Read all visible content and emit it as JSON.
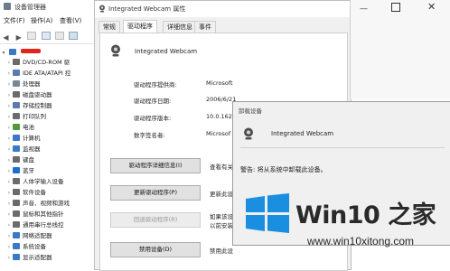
{
  "device_manager": {
    "title": "设备管理器",
    "menu": [
      "文件(F)",
      "操作(A)",
      "查看(V)"
    ],
    "tree": [
      {
        "label": "DVD/CD-ROM 驱",
        "color": "#6b6b6b"
      },
      {
        "label": "IDE ATA/ATAPI 控",
        "color": "#5a7bb0"
      },
      {
        "label": "处理器",
        "color": "#7d8790"
      },
      {
        "label": "磁盘驱动器",
        "color": "#6b6b6b"
      },
      {
        "label": "存储控制器",
        "color": "#5a7bb0"
      },
      {
        "label": "打印队列",
        "color": "#6b6b6b"
      },
      {
        "label": "电池",
        "color": "#4e9a3a"
      },
      {
        "label": "计算机",
        "color": "#3a78c8"
      },
      {
        "label": "监视器",
        "color": "#3a78c8"
      },
      {
        "label": "键盘",
        "color": "#6b6b6b"
      },
      {
        "label": "蓝牙",
        "color": "#1f6fd1"
      },
      {
        "label": "人体学输入设备",
        "color": "#6b6b6b"
      },
      {
        "label": "软件设备",
        "color": "#6b6b6b"
      },
      {
        "label": "声音、视频和游戏",
        "color": "#6b6b6b"
      },
      {
        "label": "鼠标和其他指针",
        "color": "#6b6b6b"
      },
      {
        "label": "通用串行总线控",
        "color": "#6b6b6b"
      },
      {
        "label": "网络适配器",
        "color": "#3a78c8"
      },
      {
        "label": "系统设备",
        "color": "#3a78c8"
      },
      {
        "label": "显示适配器",
        "color": "#3a78c8"
      }
    ]
  },
  "properties": {
    "title": "Integrated Webcam 属性",
    "tabs": [
      "常规",
      "驱动程序",
      "详细信息",
      "事件"
    ],
    "device_name": "Integrated Webcam",
    "fields": [
      {
        "label": "驱动程序提供商:",
        "value": "Microsoft"
      },
      {
        "label": "驱动程序日期:",
        "value": "2006/6/21"
      },
      {
        "label": "驱动程序版本:",
        "value": "10.0.1629"
      },
      {
        "label": "数字签名者:",
        "value": "Microsof"
      }
    ],
    "buttons": [
      {
        "label": "驱动程序详细信息(I)",
        "desc": "查看有关"
      },
      {
        "label": "更新驱动程序(P)",
        "desc": "更新此设"
      },
      {
        "label": "回退驱动程序(R)",
        "desc": "如果该设\n以前安装"
      },
      {
        "label": "禁用设备(D)",
        "desc": "禁用此设"
      }
    ]
  },
  "uninstall_dialog": {
    "title": "卸载设备",
    "device_name": "Integrated Webcam",
    "warning": "警告: 将从系统中卸载此设备。"
  },
  "watermark": {
    "name": "Win10 之家",
    "url": "www.win10xitong.com",
    "colors": {
      "logo": "#1a8fe0"
    }
  }
}
